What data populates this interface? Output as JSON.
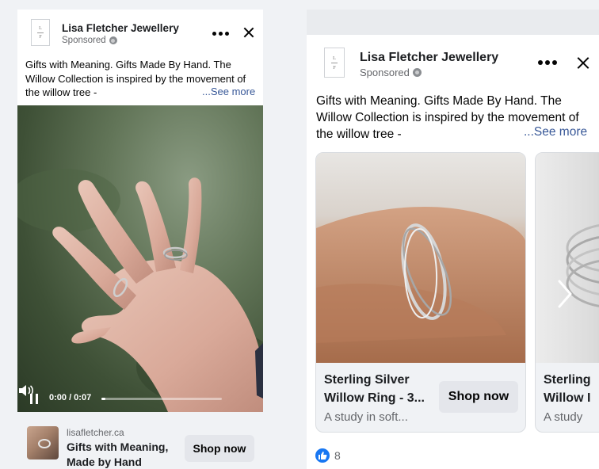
{
  "colors": {
    "accent_link": "#385898",
    "secondary_text": "#65676b",
    "button_bg": "#e4e6eb",
    "like_blue": "#1877f2",
    "page_bg": "#f0f2f5"
  },
  "left_ad": {
    "brand": "Lisa Fletcher Jewellery",
    "sponsored": "Sponsored",
    "logo_letters": [
      "L",
      "F"
    ],
    "icons": [
      "globe-icon",
      "more-icon",
      "close-icon"
    ],
    "body": "Gifts with Meaning. Gifts Made By Hand. The Willow Collection is inspired by the movement of the willow tree -",
    "see_more": "...See more",
    "video": {
      "time": "0:00 / 0:07",
      "progress_fraction": 0.03,
      "icons": [
        "pause-icon",
        "volume-icon"
      ]
    },
    "footer": {
      "domain": "lisafletcher.ca",
      "headline": "Gifts with Meaning, Made by Hand",
      "cta": "Shop now"
    }
  },
  "right_ad": {
    "brand": "Lisa Fletcher Jewellery",
    "sponsored": "Sponsored",
    "logo_letters": [
      "L",
      "F"
    ],
    "body": "Gifts with Meaning. Gifts Made By Hand. The Willow Collection is inspired by the movement of the willow tree -",
    "see_more": "...See more",
    "carousel": [
      {
        "title_line1": "Sterling Silver",
        "title_line2": "Willow Ring - 3...",
        "description": "A study in soft...",
        "cta": "Shop now"
      },
      {
        "title_line1": "Sterling",
        "title_line2": "Willow I",
        "description": "A study"
      }
    ],
    "reaction_count": "8"
  }
}
